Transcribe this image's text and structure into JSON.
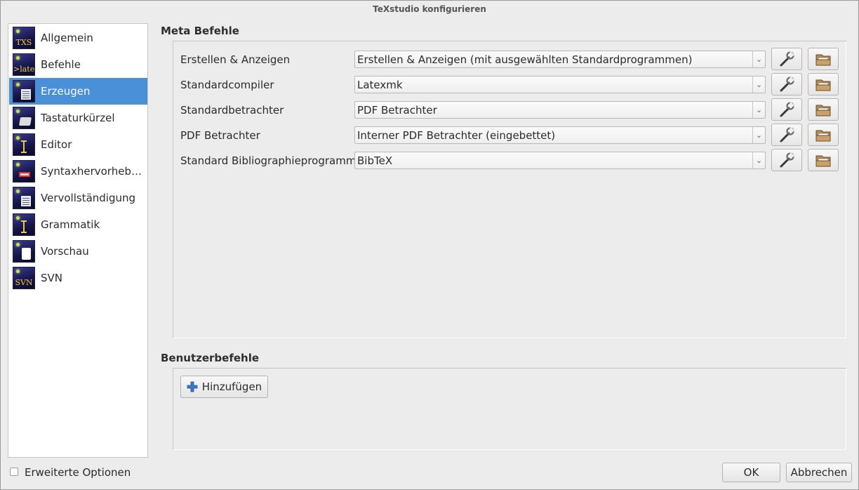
{
  "window": {
    "title": "TeXstudio konfigurieren"
  },
  "sidebar": {
    "items": [
      {
        "label": "Allgemein",
        "icon": "txs-icon",
        "glyph": "TXS"
      },
      {
        "label": "Befehle",
        "icon": "latex-icon",
        "glyph": ">latex"
      },
      {
        "label": "Erzeugen",
        "icon": "build-icon",
        "glyph": ""
      },
      {
        "label": "Tastaturkürzel",
        "icon": "keyboard-icon",
        "glyph": ""
      },
      {
        "label": "Editor",
        "icon": "text-cursor-icon",
        "glyph": ""
      },
      {
        "label": "Syntaxhervorheb…",
        "icon": "highlight-icon",
        "glyph": ""
      },
      {
        "label": "Vervollständigung",
        "icon": "completion-icon",
        "glyph": ""
      },
      {
        "label": "Grammatik",
        "icon": "grammar-icon",
        "glyph": ""
      },
      {
        "label": "Vorschau",
        "icon": "preview-icon",
        "glyph": ""
      },
      {
        "label": "SVN",
        "icon": "svn-icon",
        "glyph": "SVN"
      }
    ],
    "selected_index": 2
  },
  "meta": {
    "title": "Meta Befehle",
    "rows": [
      {
        "label": "Erstellen & Anzeigen",
        "value": "Erstellen & Anzeigen (mit ausgewählten Standardprogrammen)"
      },
      {
        "label": "Standardcompiler",
        "value": "Latexmk"
      },
      {
        "label": "Standardbetrachter",
        "value": "PDF Betrachter"
      },
      {
        "label": "PDF Betrachter",
        "value": "Interner PDF Betrachter (eingebettet)"
      },
      {
        "label": "Standard Bibliographieprogramm",
        "value": "BibTeX"
      }
    ]
  },
  "user": {
    "title": "Benutzerbefehle",
    "add_label": "Hinzufügen"
  },
  "footer": {
    "advanced_label": "Erweiterte Optionen",
    "advanced_checked": false,
    "ok_label": "OK",
    "cancel_label": "Abbrechen"
  },
  "colors": {
    "selection": "#4a90d9",
    "add_icon": "#2f6fc0"
  }
}
